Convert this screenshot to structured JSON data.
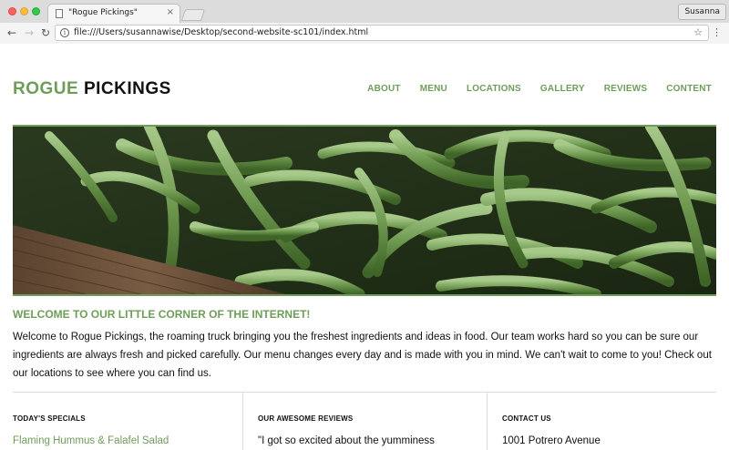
{
  "browser": {
    "tab_title": "\"Rogue Pickings\"",
    "tab_close": "×",
    "profile_name": "Susanna",
    "url": "file:///Users/susannawise/Desktop/second-website-sc101/index.html"
  },
  "site": {
    "logo_first": "ROGUE",
    "logo_second": "PICKINGS",
    "nav": [
      "ABOUT",
      "MENU",
      "LOCATIONS",
      "GALLERY",
      "REVIEWS",
      "CONTENT"
    ],
    "brand_color": "#6e9d5a"
  },
  "welcome": {
    "title": "WELCOME TO OUR LITTLE CORNER OF THE INTERNET!",
    "text": "Welcome to Rogue Pickings, the roaming truck bringing you the freshest ingredients and ideas in food. Our team works hard so you can be sure our ingredients are always fresh and picked carefully. Our menu changes every day and is made with you in mind. We can't wait to come to you! Check out our locations to see where you can find us."
  },
  "columns": [
    {
      "heading": "TODAY'S SPECIALS",
      "body": "Flaming Hummus & Falafel Salad"
    },
    {
      "heading": "OUR AWESOME REVIEWS",
      "body": "\"I got so excited about the yumminess"
    },
    {
      "heading": "CONTACT US",
      "body": "1001 Potrero Avenue"
    }
  ],
  "icons": {
    "back": "arrow-left-icon",
    "forward": "arrow-right-icon",
    "reload": "reload-icon",
    "info": "info-icon",
    "bookmark": "star-icon",
    "menu": "kebab-menu-icon"
  }
}
